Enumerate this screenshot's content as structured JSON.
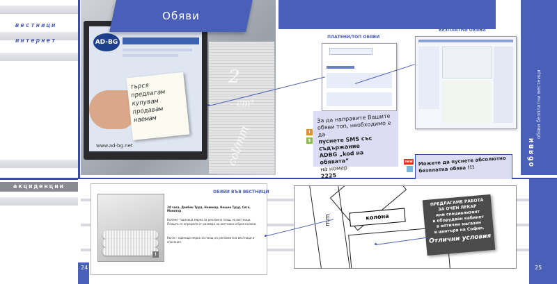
{
  "sidebar": {
    "word1": "вестници",
    "word2": "интернет",
    "section2": "акциденции"
  },
  "top_left": {
    "title": "Обяви",
    "site_logo": "AD-BG",
    "site_url": "www.ad-bg.net",
    "note_lines": [
      "търся",
      "предлагам",
      "купувам",
      "продавам",
      "наемам"
    ],
    "formula_1": "2",
    "formula_2": "cm³",
    "formula_3": "col/mm"
  },
  "top_right": {
    "paid_label": "ПЛАТЕНИ/ТОП ОБЯВИ",
    "free_label": "БЕЗПЛАТНИ ОБЯВИ",
    "sms_lines": [
      "За да направите Вашите",
      "обяви топ, необходимо е да",
      "пуснете SMS със съдържание",
      "ADBG „kod на обявата“",
      "на номер",
      "2225"
    ],
    "free_lines": [
      "Можете да пуснете абсолютно",
      "безплатна обява !!!"
    ],
    "new_badge": "new",
    "side_vertical": "обяви безплатни вестници",
    "side_big": "обяви"
  },
  "bottom": {
    "news_heading": "ОБЯВИ ВЪВ ВЕСТНИЦИ",
    "news_names": "24 часа, Днебен Труд, Новинар, Нощен Труд, Сега, Монитор",
    "news_p1": "Кол/мм - единица мярка за рекламна площ на вестници. Площта се определя от размера на вестника и броя колони.",
    "news_p2": "Кв.см - единица мярка за площ на рекламата в вестници и списания.",
    "map_kolona": "колона",
    "map_mm": "mm",
    "job_lines": [
      "ПРЕДЛАГАМЕ РАБОТА",
      "ЗА ОЧЕН ЛЕКАР",
      "или специализант",
      "в оборудван кабинет",
      "в оптичен магазин",
      "в центъра на София."
    ],
    "job_tagline": "Отлични условия",
    "page_left": "24",
    "page_right": "25"
  }
}
